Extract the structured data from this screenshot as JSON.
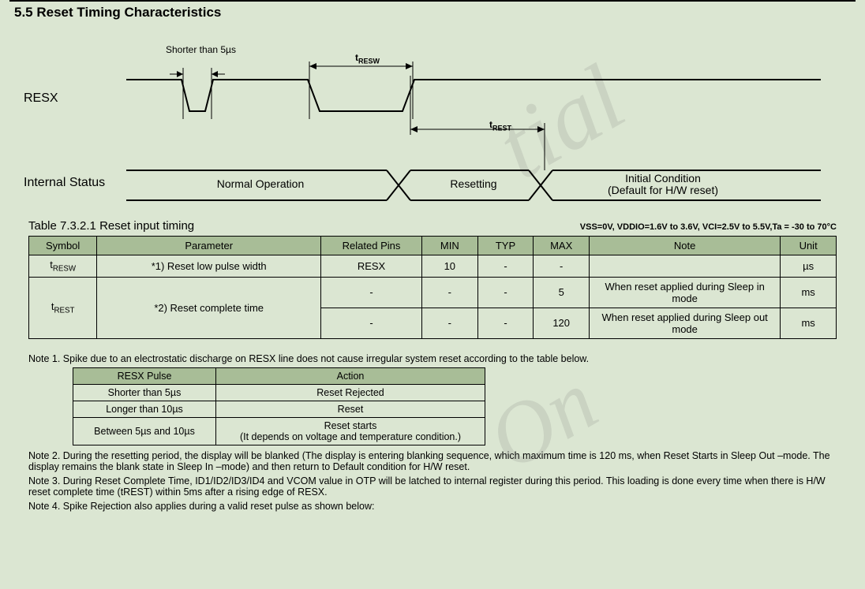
{
  "section_title": "5.5 Reset Timing Characteristics",
  "diagram": {
    "shorter_label": "Shorter than 5µs",
    "tresw_label": "tRESW",
    "trest_label": "tREST",
    "resx_label": "RESX",
    "internal_status_label": "Internal Status",
    "state_normal": "Normal Operation",
    "state_resetting": "Resetting",
    "state_initial_l1": "Initial Condition",
    "state_initial_l2": "(Default for H/W reset)"
  },
  "table1": {
    "title": "Table 7.3.2.1 Reset input timing",
    "conditions": "VSS=0V, VDDIO=1.6V to 3.6V, VCI=2.5V to 5.5V,Ta = -30 to 70°C",
    "headers": {
      "symbol": "Symbol",
      "parameter": "Parameter",
      "pins": "Related Pins",
      "min": "MIN",
      "typ": "TYP",
      "max": "MAX",
      "note": "Note",
      "unit": "Unit"
    },
    "rows": [
      {
        "symbol": "tRESW",
        "parameter": "*1) Reset low pulse width",
        "pins": "RESX",
        "min": "10",
        "typ": "-",
        "max": "-",
        "note": "",
        "unit": "µs"
      },
      {
        "symbol": "tREST",
        "parameter": "*2) Reset complete time",
        "sub": [
          {
            "pins": "-",
            "min": "-",
            "typ": "-",
            "max": "5",
            "note": "When reset applied during Sleep in mode",
            "unit": "ms"
          },
          {
            "pins": "-",
            "min": "-",
            "typ": "-",
            "max": "120",
            "note": "When reset applied during Sleep out mode",
            "unit": "ms"
          }
        ]
      }
    ]
  },
  "note1": {
    "text": "Note 1. Spike due to an electrostatic discharge on RESX line does not cause irregular system reset according to the table below.",
    "headers": {
      "pulse": "RESX Pulse",
      "action": "Action"
    },
    "rows": [
      {
        "pulse": "Shorter than 5µs",
        "action": "Reset Rejected"
      },
      {
        "pulse": "Longer than 10µs",
        "action": "Reset"
      },
      {
        "pulse": "Between 5µs and 10µs",
        "action_l1": "Reset starts",
        "action_l2": "(It depends on voltage and temperature condition.)"
      }
    ]
  },
  "note2": "Note 2. During the resetting period, the display will be blanked (The display is entering blanking sequence, which maximum time is 120 ms, when Reset Starts in Sleep Out –mode. The display remains the blank state in Sleep In –mode) and then return to Default condition for H/W reset.",
  "note3": "Note 3. During Reset Complete Time, ID1/ID2/ID3/ID4 and VCOM value in OTP will be latched to internal register during this period. This loading is done every time when there is H/W reset complete time (tREST) within 5ms after a rising edge of RESX.",
  "note4": "Note 4. Spike Rejection also applies during a valid reset pulse as shown below:"
}
